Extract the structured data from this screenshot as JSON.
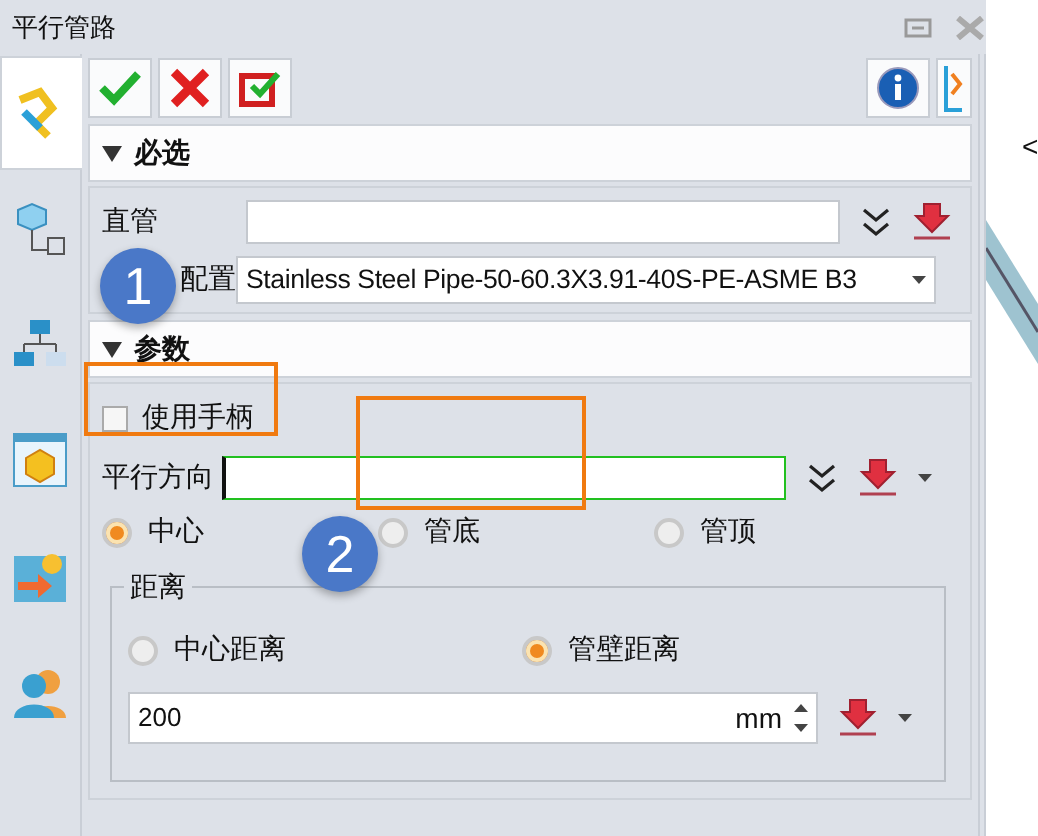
{
  "window": {
    "title": "平行管路"
  },
  "side_tabs": [
    {
      "selected": true
    },
    {
      "selected": false
    },
    {
      "selected": false
    },
    {
      "selected": false
    },
    {
      "selected": false
    },
    {
      "selected": false
    }
  ],
  "sections": [
    {
      "title": "必选",
      "expanded": true
    },
    {
      "title": "参数",
      "expanded": true
    }
  ],
  "required": {
    "pipe": {
      "label": "直管"
    },
    "config": {
      "label": "配置",
      "value": "Stainless Steel Pipe-50-60.3X3.91-40S-PE-ASME B3"
    }
  },
  "params": {
    "use_handle": {
      "label": "使用手柄",
      "checked": false
    },
    "direction": {
      "label": "平行方向",
      "focused": true
    },
    "align": [
      {
        "label": "中心",
        "selected": true
      },
      {
        "label": "管底",
        "selected": false
      },
      {
        "label": "管顶",
        "selected": false
      }
    ],
    "distance": {
      "title": "距离",
      "modes": [
        {
          "label": "中心距离",
          "selected": false
        },
        {
          "label": "管壁距离",
          "selected": true
        }
      ],
      "value": "200",
      "unit": "mm"
    }
  },
  "annotations": [
    {
      "label": "1"
    },
    {
      "label": "2"
    }
  ],
  "canvas_text": [
    "<"
  ]
}
